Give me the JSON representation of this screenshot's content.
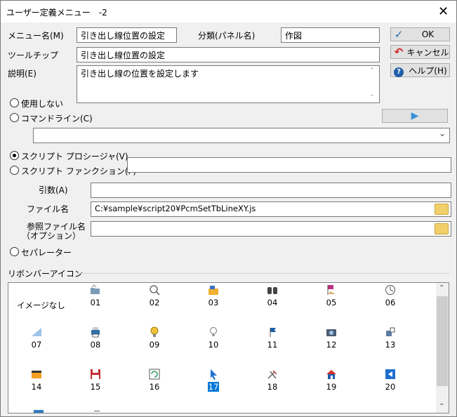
{
  "window": {
    "title": "ユーザー定義メニュー　-2",
    "close_glyph": "✕"
  },
  "form": {
    "menu_name_label": "メニュー名(M)",
    "menu_name_value": "引き出し線位置の設定",
    "category_label": "分類(パネル名)",
    "category_value": "作図",
    "tooltip_label": "ツールチップ",
    "tooltip_value": "引き出し線位置の設定",
    "description_label": "説明(E)",
    "description_value": "引き出し線の位置を設定します",
    "unused_label": "使用しない",
    "commandline_label": "コマンドライン(C)",
    "commandline_value": "",
    "script_procedure_label": "スクリプト プロシージャ(V)",
    "script_function_label": "スクリプト ファンクション(F)",
    "script_function_value": "",
    "args_label": "引数(A)",
    "args_value": "",
    "file_label": "ファイル名",
    "file_value": "C:¥sample¥script20¥PcmSetTbLineXY.js",
    "ref_file_label_1": "参照ファイル名",
    "ref_file_label_2": "（オプション）",
    "ref_file_value": "",
    "separator_label": "セパレーター",
    "selected_mode": "script_procedure"
  },
  "buttons": {
    "ok": "OK",
    "cancel": "キャンセル",
    "help": "ヘルプ(H)",
    "run_glyph": "▶"
  },
  "ribbon": {
    "group_label": "リボンバーアイコン",
    "no_image_label": "イメージなし",
    "selected": "17",
    "icons": [
      {
        "num": "01",
        "icon": "folder-open-icon"
      },
      {
        "num": "02",
        "icon": "magnifier-icon"
      },
      {
        "num": "03",
        "icon": "folder-icon"
      },
      {
        "num": "04",
        "icon": "binoculars-icon"
      },
      {
        "num": "05",
        "icon": "flag-icon"
      },
      {
        "num": "06",
        "icon": "clock-icon"
      },
      {
        "num": "07",
        "icon": "ruler-icon"
      },
      {
        "num": "08",
        "icon": "printer-icon"
      },
      {
        "num": "09",
        "icon": "bulb-on-icon"
      },
      {
        "num": "10",
        "icon": "bulb-off-icon"
      },
      {
        "num": "11",
        "icon": "pin-flag-icon"
      },
      {
        "num": "12",
        "icon": "camera-icon"
      },
      {
        "num": "13",
        "icon": "puzzle-icon"
      },
      {
        "num": "14",
        "icon": "window-icon"
      },
      {
        "num": "15",
        "icon": "save-icon"
      },
      {
        "num": "16",
        "icon": "refresh-icon"
      },
      {
        "num": "17",
        "icon": "cursor-icon"
      },
      {
        "num": "18",
        "icon": "tools-icon"
      },
      {
        "num": "19",
        "icon": "house-icon"
      },
      {
        "num": "20",
        "icon": "arrow-left-icon"
      }
    ]
  },
  "colors": {
    "accent": "#0078d7",
    "ok_check": "#1f6fb5",
    "cancel_arrow": "#d42020",
    "help_blue": "#1f5ea8",
    "run_arrow": "#3b8fd9"
  }
}
